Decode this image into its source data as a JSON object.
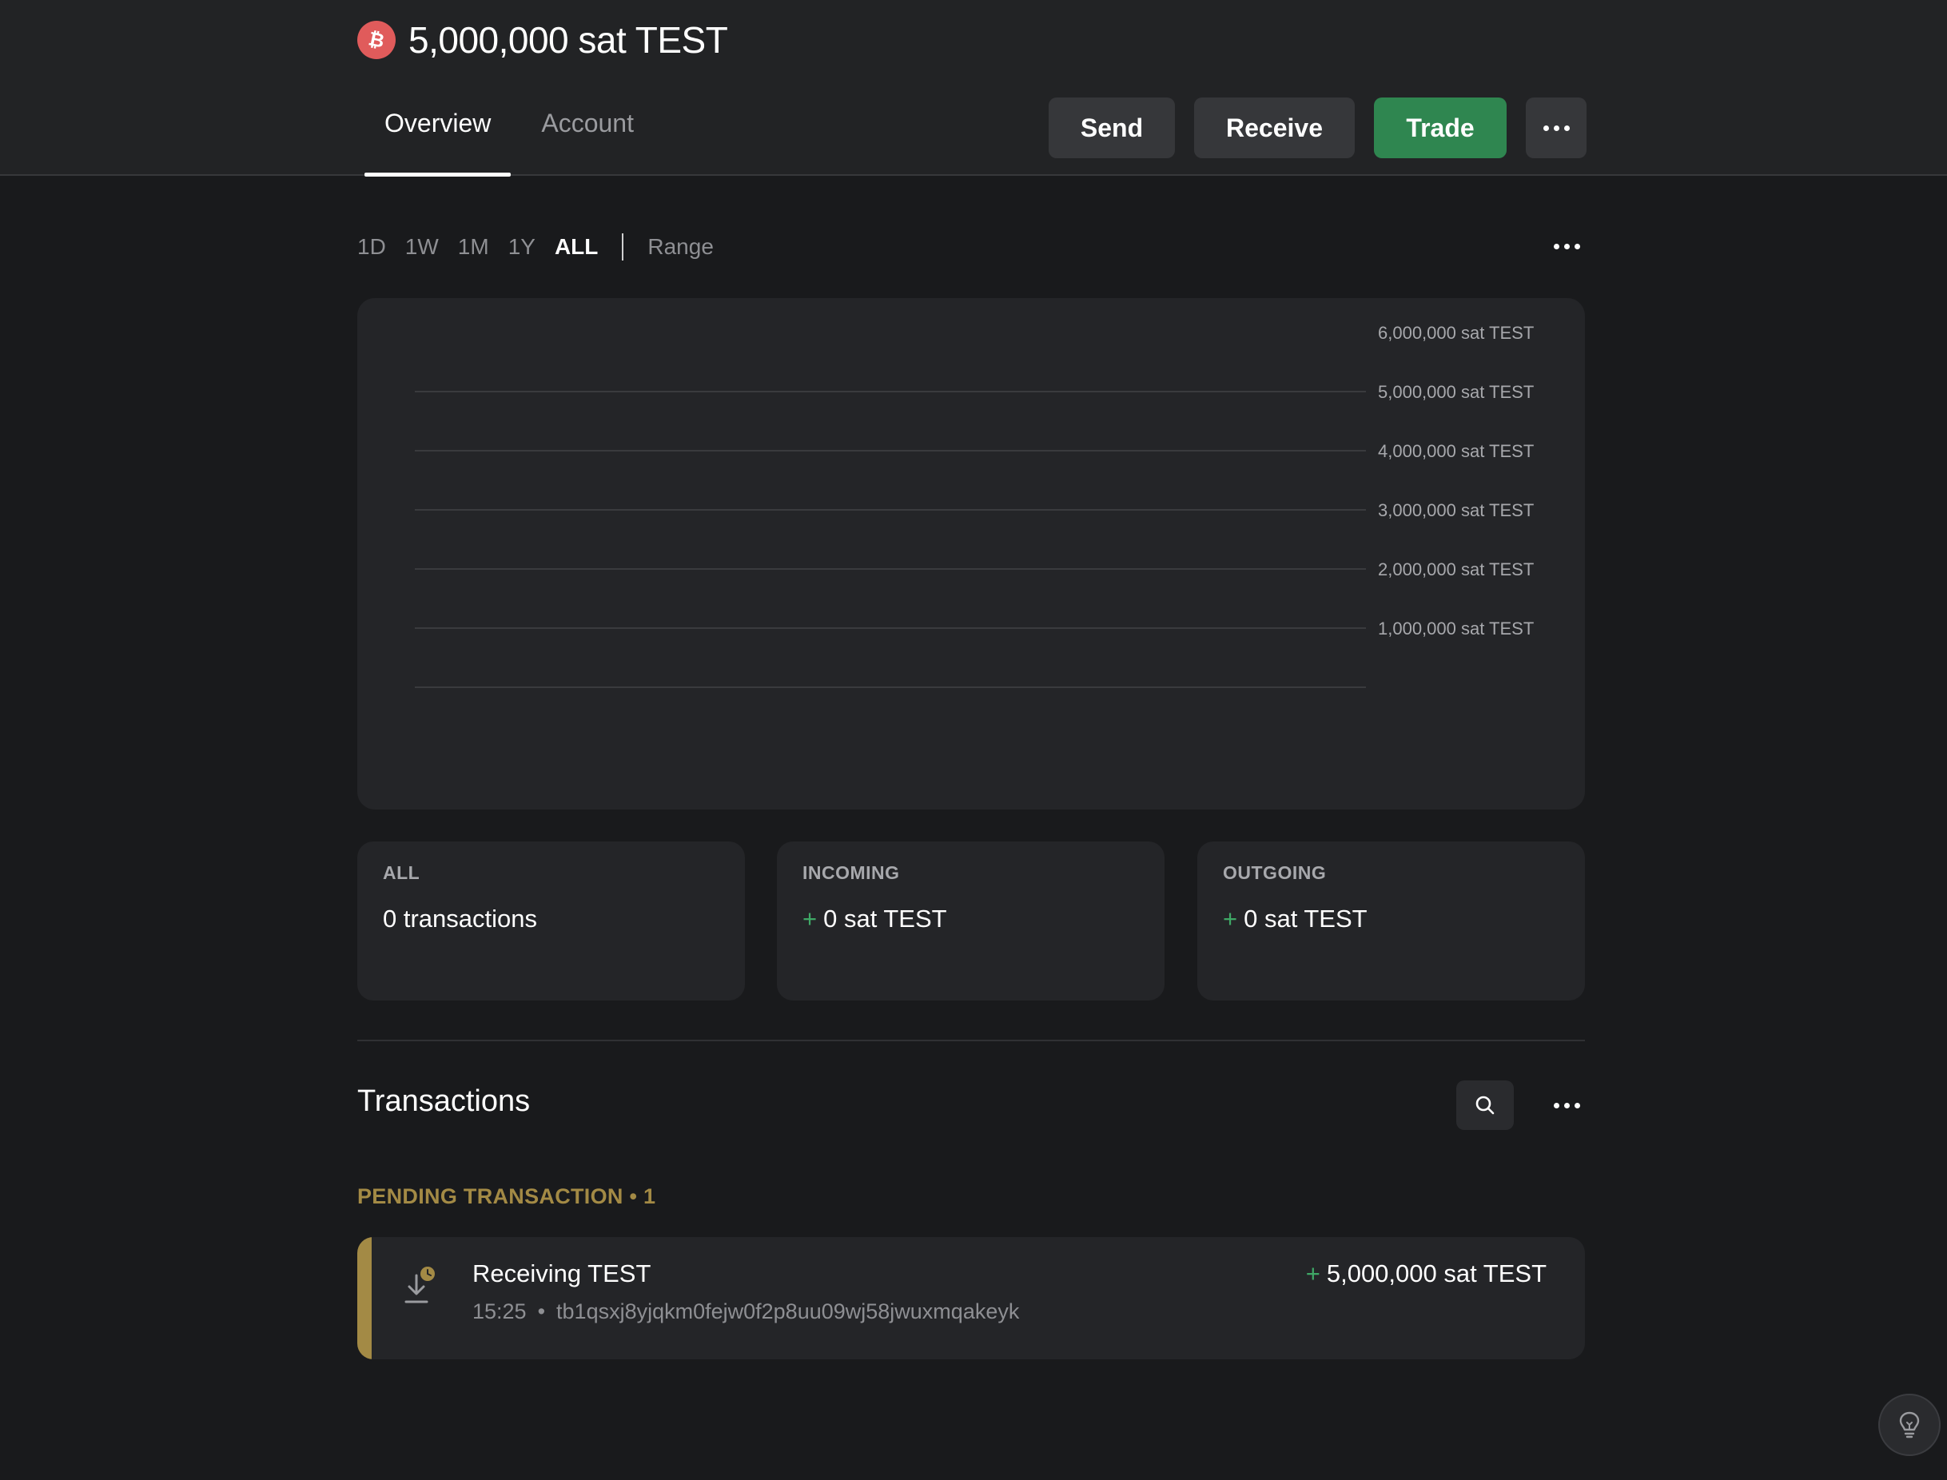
{
  "header": {
    "title": "5,000,000 sat TEST",
    "coin_icon": "bitcoin-icon",
    "tabs": [
      {
        "label": "Overview",
        "active": true
      },
      {
        "label": "Account",
        "active": false
      }
    ],
    "actions": {
      "send": "Send",
      "receive": "Receive",
      "trade": "Trade",
      "more_icon": "ellipsis-icon"
    }
  },
  "range": {
    "options": [
      "1D",
      "1W",
      "1M",
      "1Y",
      "ALL"
    ],
    "selected": "ALL",
    "range_label": "Range"
  },
  "chart_data": {
    "type": "line",
    "title": "",
    "xlabel": "",
    "ylabel": "",
    "ylim": [
      0,
      6000000
    ],
    "y_ticks": [
      {
        "value": 6000000,
        "label": "6,000,000 sat TEST"
      },
      {
        "value": 5000000,
        "label": "5,000,000 sat TEST"
      },
      {
        "value": 4000000,
        "label": "4,000,000 sat TEST"
      },
      {
        "value": 3000000,
        "label": "3,000,000 sat TEST"
      },
      {
        "value": 2000000,
        "label": "2,000,000 sat TEST"
      },
      {
        "value": 1000000,
        "label": "1,000,000 sat TEST"
      }
    ],
    "grid": true,
    "series": []
  },
  "stats": [
    {
      "label": "ALL",
      "value": "0 transactions",
      "sign": ""
    },
    {
      "label": "INCOMING",
      "value": "0 sat TEST",
      "sign": "+"
    },
    {
      "label": "OUTGOING",
      "value": "0 sat TEST",
      "sign": "+"
    }
  ],
  "transactions": {
    "title": "Transactions",
    "pending_label": "PENDING TRANSACTION • 1",
    "items": [
      {
        "name": "Receiving TEST",
        "time": "15:25",
        "separator": "•",
        "address": "tb1qsxj8yjqkm0fejw0f2p8uu09wj58jwuxmqakeyk",
        "amount_sign": "+",
        "amount": "5,000,000 sat TEST",
        "icon": "pending-receive-icon"
      }
    ]
  },
  "colors": {
    "background": "#191a1c",
    "card": "#242528",
    "accent_green": "#2f8650",
    "pending_gold": "#a38a45",
    "coin_red": "#e05b5b"
  }
}
